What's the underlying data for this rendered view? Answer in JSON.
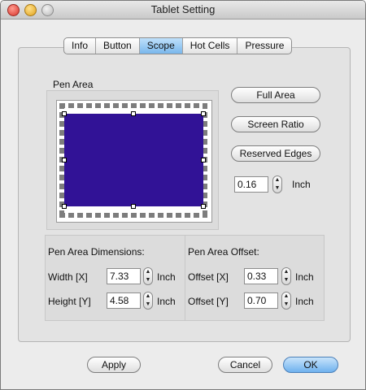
{
  "window": {
    "title": "Tablet Setting"
  },
  "tabs": [
    {
      "label": "Info"
    },
    {
      "label": "Button"
    },
    {
      "label": "Scope",
      "active": true
    },
    {
      "label": "Hot Cells"
    },
    {
      "label": "Pressure"
    }
  ],
  "pen_area": {
    "label": "Pen Area",
    "fill_color": "#311296"
  },
  "actions": {
    "full_area": "Full Area",
    "screen_ratio": "Screen Ratio",
    "reserved_edges": "Reserved Edges"
  },
  "reserved": {
    "value": "0.16",
    "unit": "Inch"
  },
  "dimensions": {
    "title": "Pen Area Dimensions:",
    "width_label": "Width  [X]",
    "width_value": "7.33",
    "height_label": "Height [Y]",
    "height_value": "4.58",
    "unit": "Inch"
  },
  "offset": {
    "title": "Pen Area Offset:",
    "x_label": "Offset [X]",
    "x_value": "0.33",
    "y_label": "Offset [Y]",
    "y_value": "0.70",
    "unit": "Inch"
  },
  "footer": {
    "apply": "Apply",
    "cancel": "Cancel",
    "ok": "OK"
  }
}
